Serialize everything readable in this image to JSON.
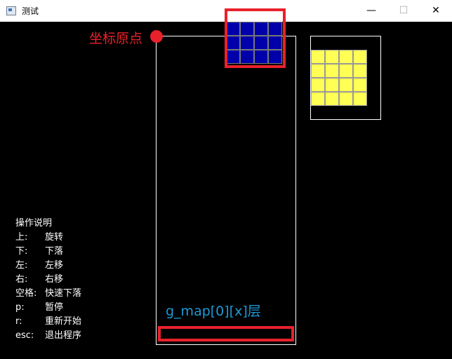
{
  "window": {
    "title": "测试",
    "controls": {
      "minimize": "—",
      "maximize": "☐",
      "close": "✕"
    }
  },
  "annotations": {
    "origin_label": "坐标原点",
    "layer_label": "g_map[0][x]层",
    "highlight_color": "#e8212a",
    "layer_label_color": "#1e9ad6"
  },
  "pieces": {
    "active_color": "#0000aa",
    "next_color": "#ffff55"
  },
  "help": {
    "title": "操作说明",
    "rows": [
      {
        "key": "上:",
        "action": "旋转"
      },
      {
        "key": "下:",
        "action": "下落"
      },
      {
        "key": "左:",
        "action": "左移"
      },
      {
        "key": "右:",
        "action": "右移"
      },
      {
        "key": "空格:",
        "action": "快速下落"
      },
      {
        "key": "p:",
        "action": "暂停"
      },
      {
        "key": "r:",
        "action": "重新开始"
      },
      {
        "key": "esc:",
        "action": "退出程序"
      }
    ]
  }
}
